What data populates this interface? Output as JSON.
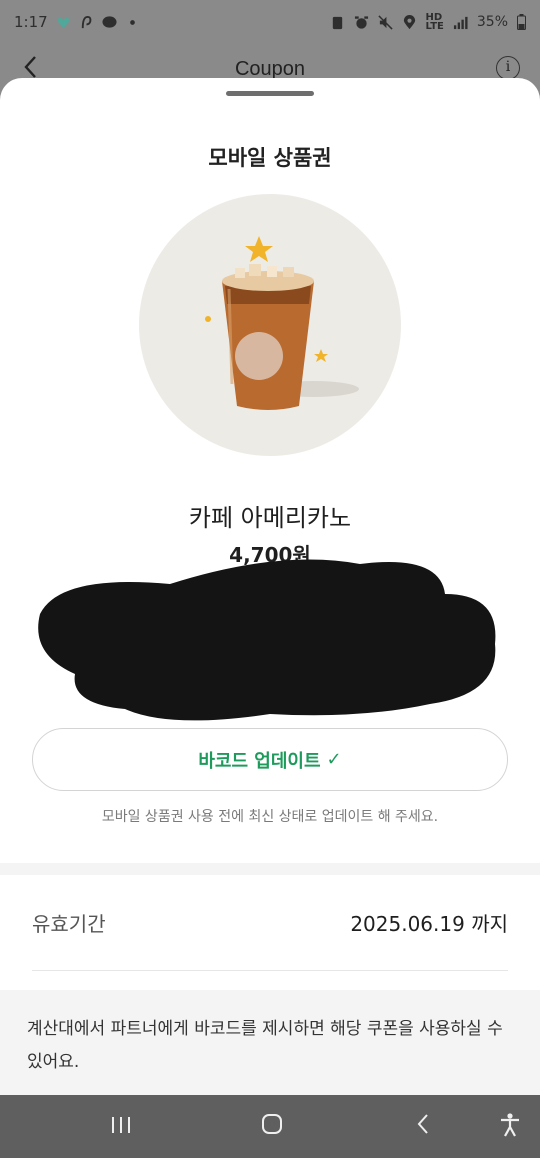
{
  "status_bar": {
    "time": "1:17",
    "network_top": "HD",
    "network_bottom": "LTE",
    "battery": "35%"
  },
  "app_header": {
    "title": "Coupon",
    "back_icon": "chevron-left-icon",
    "info_icon": "info-icon",
    "info_glyph": "i"
  },
  "sheet": {
    "title": "모바일 상품권",
    "product": {
      "name": "카페 아메리카노",
      "price": "4,700원",
      "image": "iced-americano-cup"
    },
    "barcode_button": {
      "label": "바코드 업데이트",
      "check_glyph": "✓"
    },
    "barcode_hint": "모바일 상품권 사용 전에 최신 상태로 업데이트 해 주세요.",
    "validity": {
      "label": "유효기간",
      "value": "2025.06.19 까지"
    },
    "notice": "계산대에서 파트너에게 바코드를 제시하면 해당 쿠폰을 사용하실 수 있어요."
  },
  "colors": {
    "accent_green": "#1e9b5c",
    "dim_overlay": "#8a8a8a",
    "nav_bar": "#5f5f5f"
  }
}
